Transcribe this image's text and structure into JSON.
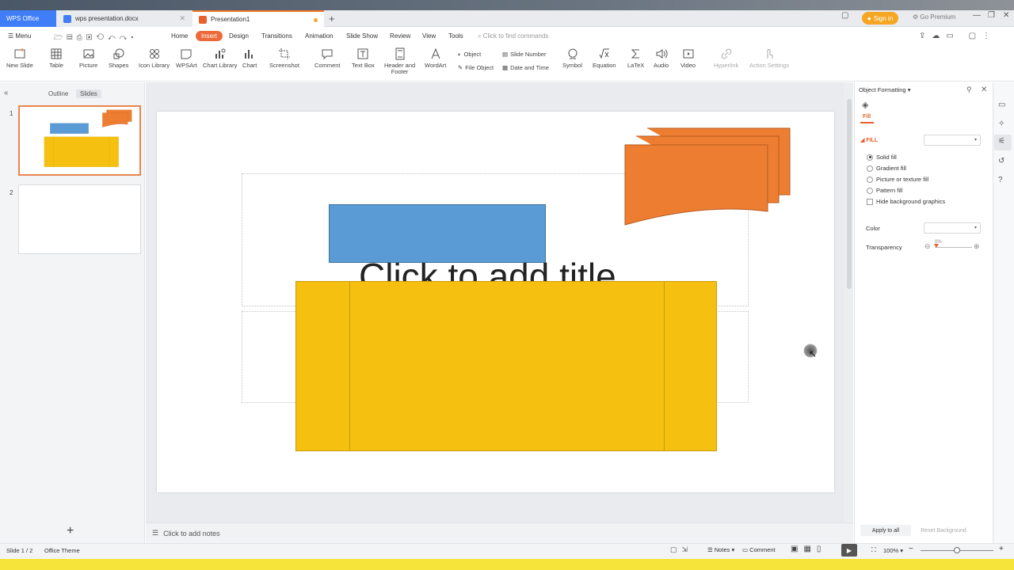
{
  "tabs": {
    "wps": "WPS Office",
    "doc": "wps presentation.docx",
    "ppt": "Presentation1"
  },
  "account": {
    "signin": "Sign in",
    "premium": "Go Premium"
  },
  "menu": {
    "menu_label": "Menu",
    "items": [
      "Home",
      "Insert",
      "Design",
      "Transitions",
      "Animation",
      "Slide Show",
      "Review",
      "View",
      "Tools"
    ],
    "active": "Insert",
    "search_placeholder": "Click to find commands"
  },
  "ribbon": {
    "new_slide": "New Slide",
    "table": "Table",
    "picture": "Picture",
    "shapes": "Shapes",
    "icon_library": "Icon Library",
    "wpsart": "WPSArt",
    "chart_library": "Chart Library",
    "chart": "Chart",
    "screenshot": "Screenshot",
    "comment": "Comment",
    "text_box": "Text Box",
    "header_footer_1": "Header and",
    "header_footer_2": "Footer",
    "wordart": "WordArt",
    "object": "Object",
    "file_object": "File Object",
    "slide_number": "Slide Number",
    "date_time": "Date and Time",
    "symbol": "Symbol",
    "equation": "Equation",
    "latex": "LaTeX",
    "audio": "Audio",
    "video": "Video",
    "hyperlink": "Hyperlink",
    "action_settings": "Action Settings"
  },
  "left_panel": {
    "outline": "Outline",
    "slides": "Slides",
    "slide_numbers": [
      "1",
      "2"
    ]
  },
  "slide": {
    "title_placeholder": "Click to add title"
  },
  "notes": {
    "placeholder": "Click to add notes"
  },
  "right_panel": {
    "title": "Object Formatting",
    "tab": "Fill",
    "section": "FILL",
    "options": [
      "Solid fill",
      "Gradient fill",
      "Picture or texture fill",
      "Pattern fill"
    ],
    "selected_option": "Solid fill",
    "hide_bg": "Hide background graphics",
    "color_label": "Color",
    "transparency_label": "Transparency",
    "transparency_value": "0%",
    "apply_all": "Apply to all",
    "reset_bg": "Reset Background"
  },
  "status": {
    "slide_pos": "Slide 1 / 2",
    "theme": "Office Theme",
    "notes": "Notes",
    "comment": "Comment",
    "zoom": "100%"
  },
  "colors": {
    "accent": "#ec6a3a",
    "blue_shape": "#5b9bd5",
    "orange_shape": "#ed7d31",
    "yellow_shape": "#f5c010"
  }
}
